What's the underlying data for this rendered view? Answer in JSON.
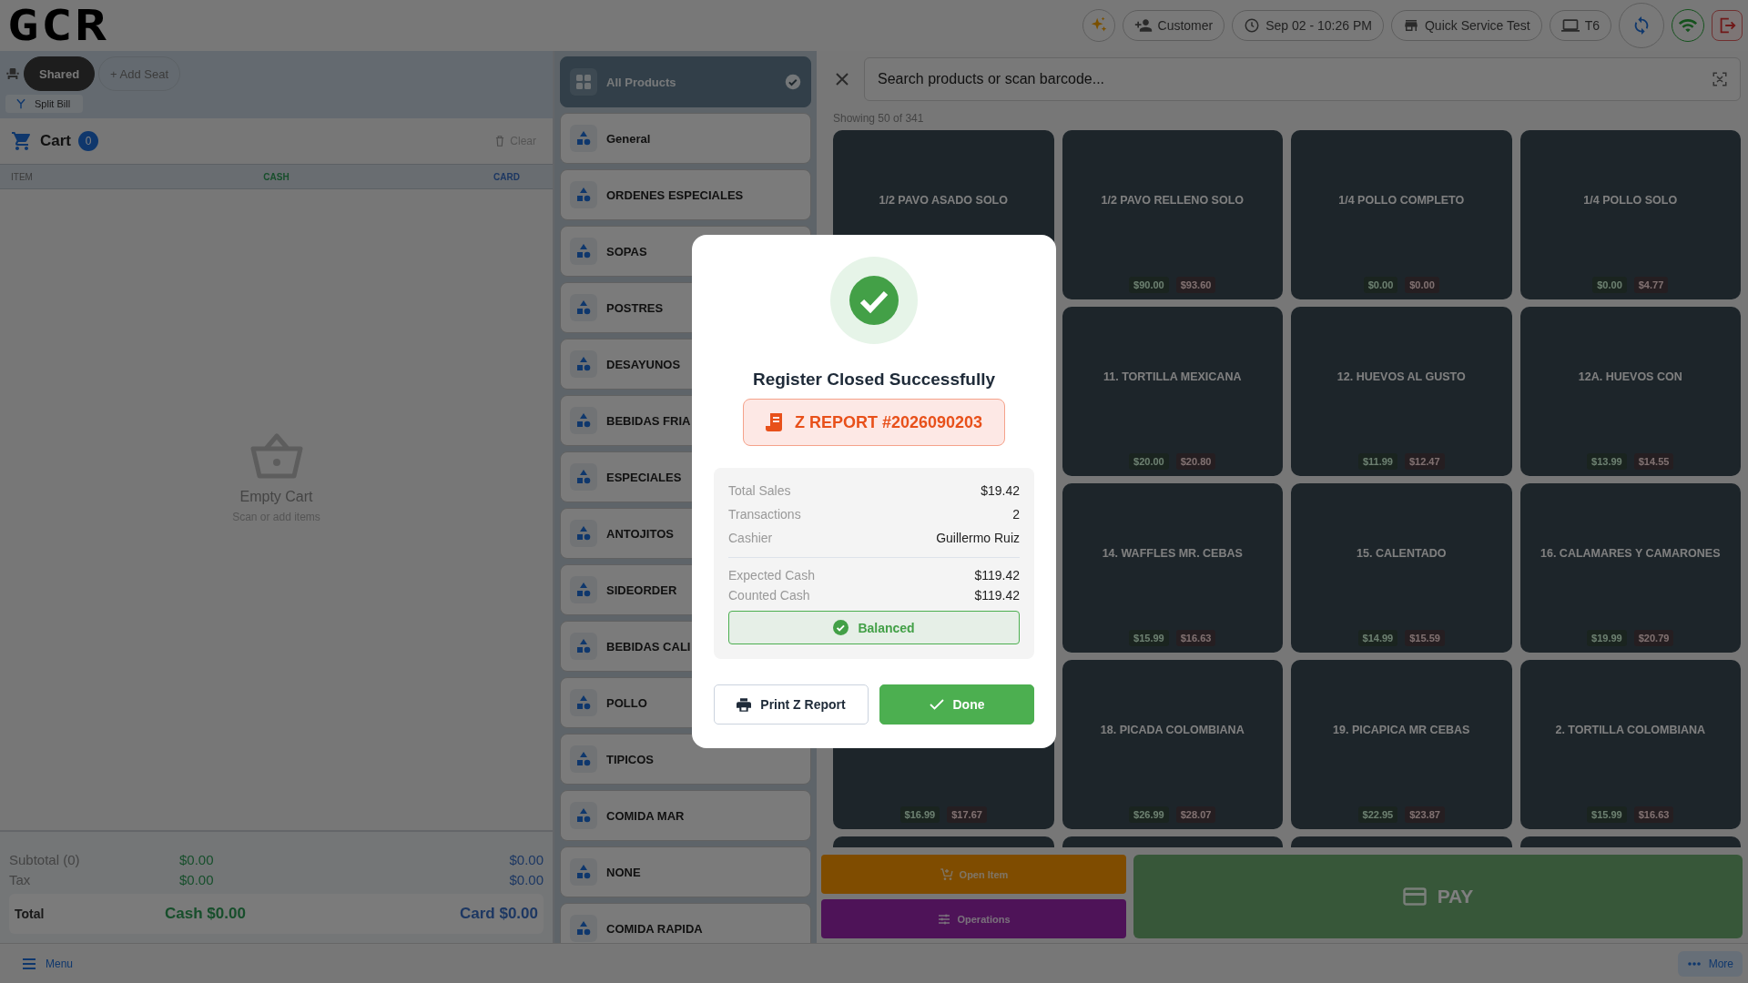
{
  "logo": "GCR",
  "top_bar": {
    "customer": "Customer",
    "datetime": "Sep 02 - 10:26 PM",
    "store": "Quick Service Test",
    "terminal": "T6"
  },
  "seats": [
    {
      "label": "Shared",
      "selected": true
    }
  ],
  "add_seat": "+ Add Seat",
  "split_bill": "Split Bill",
  "cart": {
    "title": "Cart",
    "count": "0",
    "clear": "Clear",
    "empty_title": "Empty Cart",
    "empty_hint": "Scan or add items"
  },
  "cart_columns": [
    {
      "label": "ITEM",
      "kind": "item"
    },
    {
      "label": "CASH",
      "kind": "cash"
    },
    {
      "label": "CARD",
      "kind": "card"
    }
  ],
  "totals": [
    {
      "label": "Subtotal (0)",
      "cash": "$0.00",
      "card": "$0.00"
    },
    {
      "label": "Tax",
      "cash": "$0.00",
      "card": "$0.00"
    }
  ],
  "grand_total": {
    "label": "Total",
    "cash": "Cash $0.00",
    "card": "Card $0.00"
  },
  "categories": [
    {
      "label": "All Products",
      "selected": true,
      "kind": "all"
    },
    {
      "label": "General",
      "selected": false,
      "kind": "category"
    },
    {
      "label": "ORDENES ESPECIALES",
      "selected": false,
      "kind": "category"
    },
    {
      "label": "SOPAS",
      "selected": false,
      "kind": "category"
    },
    {
      "label": "POSTRES",
      "selected": false,
      "kind": "category"
    },
    {
      "label": "DESAYUNOS",
      "selected": false,
      "kind": "category"
    },
    {
      "label": "BEBIDAS FRIA",
      "selected": false,
      "kind": "category"
    },
    {
      "label": "ESPECIALES",
      "selected": false,
      "kind": "category"
    },
    {
      "label": "ANTOJITOS",
      "selected": false,
      "kind": "category"
    },
    {
      "label": "SIDEORDER",
      "selected": false,
      "kind": "category"
    },
    {
      "label": "BEBIDAS CALI",
      "selected": false,
      "kind": "category"
    },
    {
      "label": "POLLO",
      "selected": false,
      "kind": "category"
    },
    {
      "label": "TIPICOS",
      "selected": false,
      "kind": "category"
    },
    {
      "label": "COMIDA MAR",
      "selected": false,
      "kind": "category"
    },
    {
      "label": "NONE",
      "selected": false,
      "kind": "category"
    },
    {
      "label": "COMIDA RAPIDA",
      "selected": false,
      "kind": "category"
    }
  ],
  "search": {
    "placeholder": "Search products or scan barcode..."
  },
  "showing": "Showing 50 of 341",
  "products": [
    {
      "kind": "tile",
      "name": "1/2 PAVO ASADO SOLO"
    },
    {
      "kind": "tile",
      "name": "1/2 PAVO RELLENO SOLO",
      "cash_price": "$90.00",
      "card_price": "$93.60"
    },
    {
      "kind": "tile",
      "name": "1/4 POLLO COMPLETO",
      "cash_price": "$0.00",
      "card_price": "$0.00"
    },
    {
      "kind": "tile",
      "name": "1/4 POLLO SOLO",
      "cash_price": "$0.00",
      "card_price": "$4.77"
    },
    {
      "kind": "covered"
    },
    {
      "kind": "tile",
      "name": "11. TORTILLA MEXICANA",
      "cash_price": "$20.00",
      "card_price": "$20.80"
    },
    {
      "kind": "tile",
      "name": "12. HUEVOS AL GUSTO",
      "cash_price": "$11.99",
      "card_price": "$12.47"
    },
    {
      "kind": "tile",
      "name": "12A. HUEVOS CON",
      "cash_price": "$13.99",
      "card_price": "$14.55"
    },
    {
      "kind": "covered"
    },
    {
      "kind": "tile",
      "name": "14. WAFFLES  MR. CEBAS",
      "cash_price": "$15.99",
      "card_price": "$16.63"
    },
    {
      "kind": "tile",
      "name": "15. CALENTADO",
      "cash_price": "$14.99",
      "card_price": "$15.59"
    },
    {
      "kind": "tile",
      "name": "16. CALAMARES Y CAMARONES",
      "cash_price": "$19.99",
      "card_price": "$20.79"
    },
    {
      "kind": "tile",
      "cash_price": "$16.99",
      "card_price": "$17.67"
    },
    {
      "kind": "tile",
      "name": "18. PICADA COLOMBIANA",
      "cash_price": "$26.99",
      "card_price": "$28.07"
    },
    {
      "kind": "tile",
      "name": "19. PICAPICA MR CEBAS",
      "cash_price": "$22.95",
      "card_price": "$23.87"
    },
    {
      "kind": "tile",
      "name": "2. TORTILLA COLOMBIANA",
      "cash_price": "$15.99",
      "card_price": "$16.63"
    },
    {
      "kind": "tile"
    },
    {
      "kind": "tile"
    },
    {
      "kind": "tile"
    },
    {
      "kind": "tile"
    }
  ],
  "actions": {
    "open_item": "Open Item",
    "operations": "Operations",
    "pay": "PAY"
  },
  "bottom_bar": {
    "menu": "Menu",
    "more": "More"
  },
  "dialog": {
    "title": "Register Closed Successfully",
    "report": "Z REPORT #2026090203",
    "summary": [
      {
        "label": "Total Sales",
        "value": "$19.42"
      },
      {
        "label": "Transactions",
        "value": "2"
      },
      {
        "label": "Cashier",
        "value": "Guillermo Ruiz"
      }
    ],
    "cash": [
      {
        "label": "Expected Cash",
        "value": "$119.42"
      },
      {
        "label": "Counted Cash",
        "value": "$119.42"
      }
    ],
    "status": {
      "label": "Balanced",
      "kind": "balanced"
    },
    "buttons": [
      {
        "label": "Print Z Report",
        "kind": "secondary"
      },
      {
        "label": "Done",
        "kind": "primary"
      }
    ]
  }
}
